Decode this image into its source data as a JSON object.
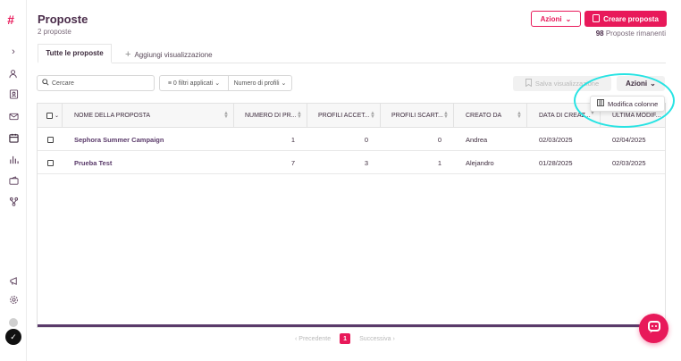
{
  "sidebar": {
    "logo": "#",
    "icons": [
      "chevron-right-icon",
      "users-icon",
      "contact-card-icon",
      "mail-icon",
      "calendar-icon",
      "bar-chart-icon",
      "wallet-icon",
      "network-icon",
      "megaphone-icon",
      "settings-icon"
    ]
  },
  "header": {
    "title": "Proposte",
    "subtitle": "2 proposte",
    "azioni_label": "Azioni",
    "create_label": "Creare proposta",
    "remaining_count": "98",
    "remaining_label": "Proposte rimanenti"
  },
  "tabs": {
    "active": "Tutte le proposte",
    "add": "Aggiungi visualizzazione"
  },
  "toolbar": {
    "search_placeholder": "Cercare",
    "filters": "0 filtri applicati",
    "profiles": "Numero di profili",
    "save_view": "Salva visualizzazione",
    "azioni": "Azioni",
    "dropdown_item": "Modifica colonne"
  },
  "table": {
    "columns": [
      "NOME DELLA PROPOSTA",
      "NUMERO DI PR...",
      "PROFILI ACCET...",
      "PROFILI SCART...",
      "CREATO DA",
      "DATA DI CREAZ...",
      "ULTIMA MODIF..."
    ],
    "rows": [
      {
        "name": "Sephora Summer Campaign",
        "num": "1",
        "accepted": "0",
        "rejected": "0",
        "creator": "Andrea",
        "created": "02/03/2025",
        "modified": "02/04/2025"
      },
      {
        "name": "Prueba Test",
        "num": "7",
        "accepted": "3",
        "rejected": "1",
        "creator": "Alejandro",
        "created": "01/28/2025",
        "modified": "02/03/2025"
      }
    ]
  },
  "pagination": {
    "prev": "Precedente",
    "page": "1",
    "next": "Successiva"
  },
  "colors": {
    "brand": "#e8195a",
    "text": "#3d2b3d",
    "highlight_ring": "#27e3e3"
  }
}
